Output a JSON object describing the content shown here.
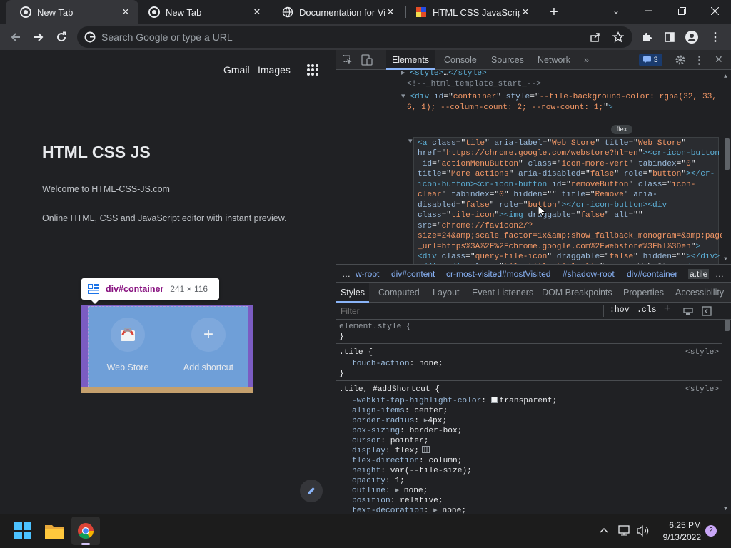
{
  "tabs": [
    {
      "title": "New Tab",
      "active": true
    },
    {
      "title": "New Tab",
      "active": false
    },
    {
      "title": "Documentation for Vis",
      "active": false
    },
    {
      "title": "HTML CSS JavaScript -",
      "active": false
    }
  ],
  "omnibox": {
    "placeholder": "Search Google or type a URL"
  },
  "ntp": {
    "links": [
      "Gmail",
      "Images"
    ],
    "title": "HTML CSS JS",
    "welcome": "Welcome to HTML-CSS-JS.com",
    "description": "Online HTML, CSS and JavaScript editor with instant preview.",
    "tooltip_tag": "div#container",
    "tooltip_size": "241 × 116",
    "tiles": [
      {
        "label": "Web Store"
      },
      {
        "label": "Add shortcut"
      }
    ]
  },
  "devtools": {
    "tabs": [
      "Elements",
      "Console",
      "Sources",
      "Network"
    ],
    "issues_count": "3",
    "breadcrumbs": [
      "w-root",
      "div#content",
      "cr-most-visited#mostVisited",
      "#shadow-root",
      "div#container",
      "a.tile"
    ],
    "subtabs": [
      "Styles",
      "Computed",
      "Layout",
      "Event Listeners",
      "DOM Breakpoints",
      "Properties",
      "Accessibility"
    ],
    "filter_placeholder": "Filter",
    "hov": ":hov",
    "cls": ".cls",
    "flex_badge": "flex",
    "element_style": "element.style {",
    "source": "<style>",
    "rules": [
      {
        "selector": ".tile {",
        "decls": [
          [
            "touch-action",
            "none;"
          ]
        ]
      },
      {
        "selector": ".tile, #addShortcut {",
        "decls": [
          [
            "-webkit-tap-highlight-color",
            "transparent;"
          ],
          [
            "align-items",
            "center;"
          ],
          [
            "border-radius",
            "4px;"
          ],
          [
            "box-sizing",
            "border-box;"
          ],
          [
            "cursor",
            "pointer;"
          ],
          [
            "display",
            "flex;"
          ],
          [
            "flex-direction",
            "column;"
          ],
          [
            "height",
            "var(--tile-size);"
          ],
          [
            "opacity",
            "1;"
          ],
          [
            "outline",
            "none;"
          ],
          [
            "position",
            "relative;"
          ],
          [
            "text-decoration",
            "none;"
          ]
        ]
      }
    ]
  },
  "taskbar": {
    "time": "6:25 PM",
    "date": "9/13/2022",
    "notifications": "2"
  },
  "colors": {
    "accent": "#8ab4f8",
    "tile_overlay": "#6f9fd8",
    "padding_overlay": "#c5a06d"
  }
}
